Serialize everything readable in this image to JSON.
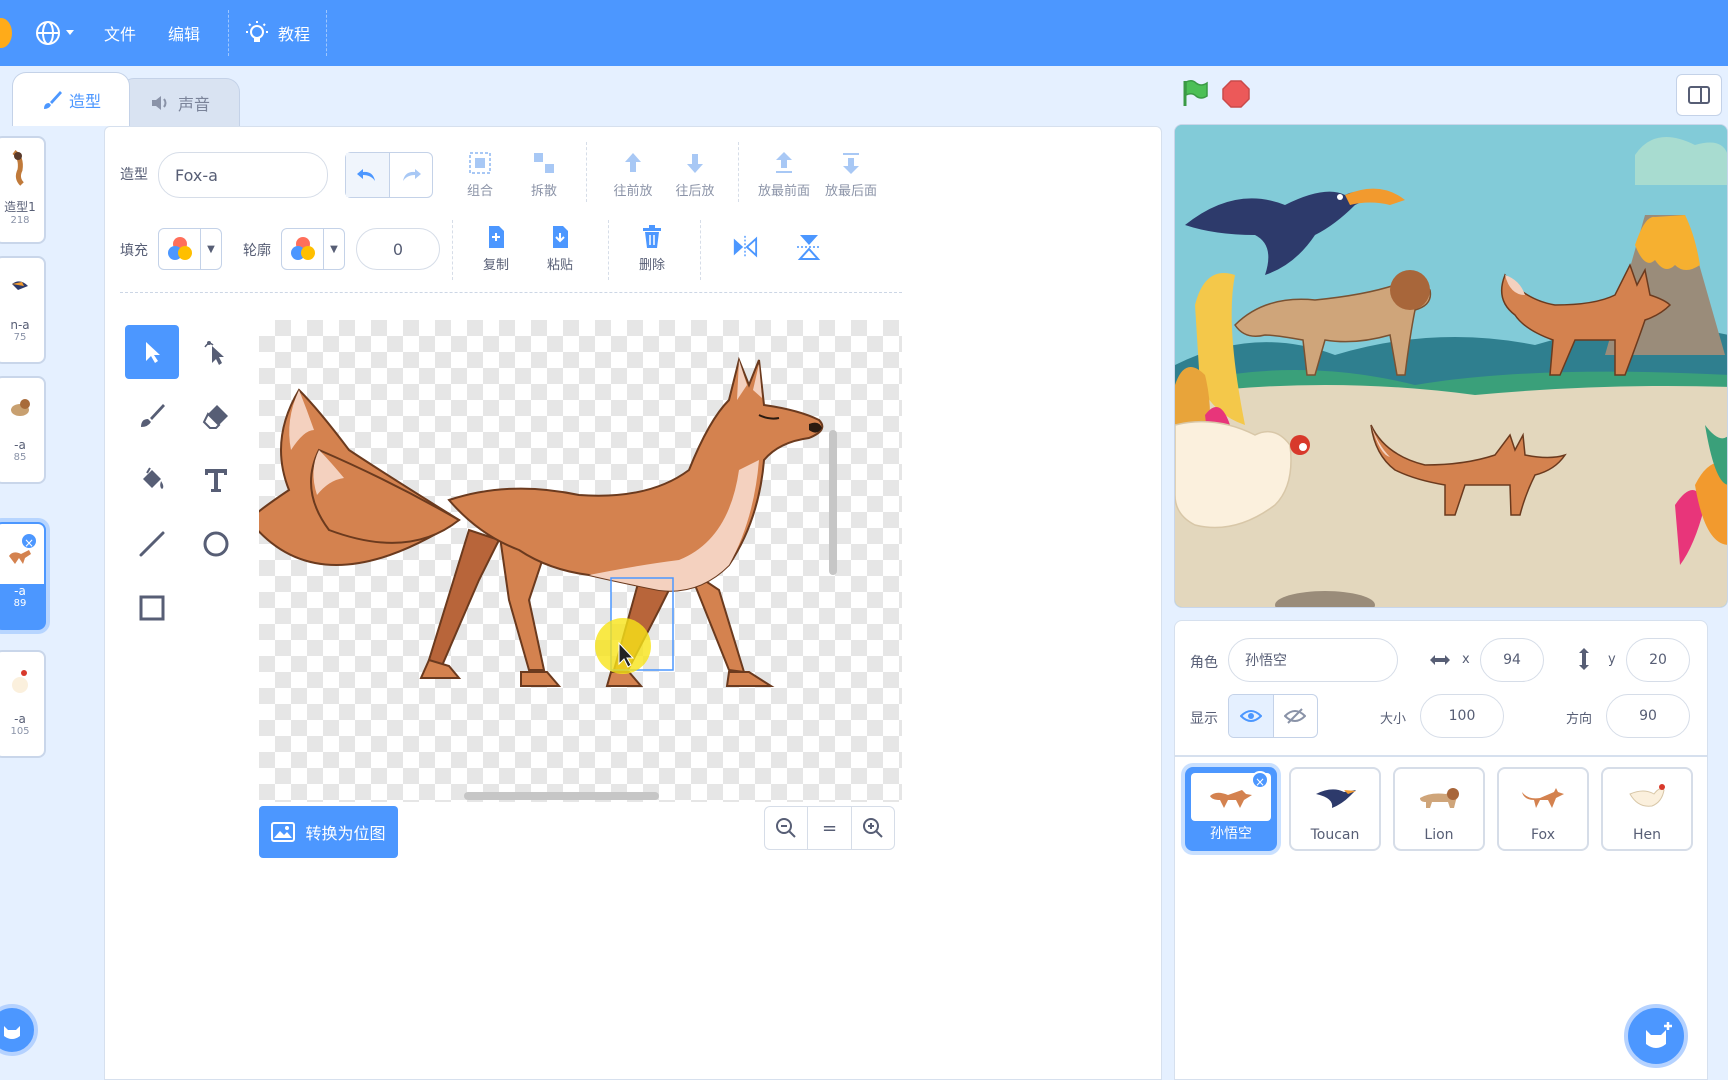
{
  "menu": {
    "file": "文件",
    "edit": "编辑",
    "tutorial": "教程"
  },
  "tabs": {
    "costumes": "造型",
    "sounds": "声音"
  },
  "costume_list": [
    {
      "name": "造型1",
      "size": "218"
    },
    {
      "name": "n-a",
      "size": "75"
    },
    {
      "name": "-a",
      "size": "85"
    },
    {
      "name": "-a",
      "size": "89"
    },
    {
      "name": "-a",
      "size": "105"
    }
  ],
  "editor": {
    "costume_label": "造型",
    "costume_name": "Fox-a",
    "group": "组合",
    "ungroup": "拆散",
    "forward": "往前放",
    "backward": "往后放",
    "front": "放最前面",
    "back": "放最后面",
    "fill_label": "填充",
    "outline_label": "轮廓",
    "outline_width": "0",
    "copy": "复制",
    "paste": "粘贴",
    "delete": "删除",
    "convert_bitmap": "转换为位图",
    "zoom_reset": "="
  },
  "sprite_info": {
    "sprite_label": "角色",
    "sprite_name": "孙悟空",
    "x_label": "x",
    "x": "94",
    "y_label": "y",
    "y": "20",
    "show_label": "显示",
    "size_label": "大小",
    "size": "100",
    "direction_label": "方向",
    "direction": "90"
  },
  "sprites": [
    {
      "name": "孙悟空",
      "selected": true
    },
    {
      "name": "Toucan",
      "selected": false
    },
    {
      "name": "Lion",
      "selected": false
    },
    {
      "name": "Fox",
      "selected": false
    },
    {
      "name": "Hen",
      "selected": false
    }
  ],
  "colors": {
    "accent": "#4c97ff",
    "fox": "#d4824f",
    "go": "#4cbf56",
    "stop": "#ec5959"
  }
}
